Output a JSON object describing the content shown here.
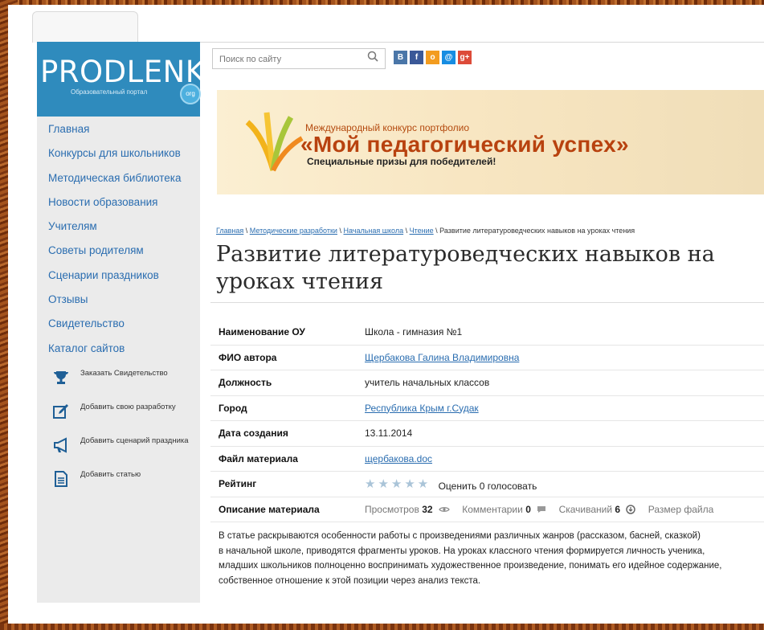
{
  "logo": {
    "text": "PRODLENKA",
    "subtitle": "Образовательный портал",
    "badge": "org"
  },
  "nav": [
    "Главная",
    "Конкурсы для школьников",
    "Методическая библиотека",
    "Новости образования",
    "Учителям",
    "Советы родителям",
    "Сценарии праздников",
    "Отзывы",
    "Свидетельство",
    "Каталог сайтов"
  ],
  "actions": [
    {
      "icon": "trophy-icon",
      "label": "Заказать Свидетельство"
    },
    {
      "icon": "edit-icon",
      "label": "Добавить свою разработку"
    },
    {
      "icon": "megaphone-icon",
      "label": "Добавить сценарий праздника"
    },
    {
      "icon": "document-icon",
      "label": "Добавить статью"
    }
  ],
  "search": {
    "placeholder": "Поиск по сайту"
  },
  "social": [
    {
      "label": "B",
      "color": "#4a76a8"
    },
    {
      "label": "f",
      "color": "#3b5998"
    },
    {
      "label": "o",
      "color": "#f39c1f"
    },
    {
      "label": "@",
      "color": "#168de2"
    },
    {
      "label": "g+",
      "color": "#dd4b39"
    }
  ],
  "banner": {
    "line1": "Международный конкурс портфолио",
    "line2": "«Мой педагогический успех»",
    "line3": "Специальные призы для победителей!"
  },
  "breadcrumb": {
    "items": [
      "Главная",
      "Методические разработки",
      "Начальная школа",
      "Чтение"
    ],
    "current": "Развитие литературоведческих навыков на уроках чтения"
  },
  "title": "Развитие литературоведческих навыков на уроках чтения",
  "info": {
    "org_label": "Наименование ОУ",
    "org_value": "Школа - гимназия №1",
    "author_label": "ФИО автора",
    "author_value": "Щербакова Галина Владимировна",
    "position_label": "Должность",
    "position_value": "учитель начальных классов",
    "city_label": "Город",
    "city_value": "Республика Крым г.Судак",
    "date_label": "Дата создания",
    "date_value": "13.11.2014",
    "file_label": "Файл материала",
    "file_value": "щербакова.doc",
    "rating_label": "Рейтинг",
    "rating_stars": "★★★★★",
    "rate_link": "Оценить",
    "votes": "0 голосовать",
    "desc_label": "Описание материала",
    "views_label": "Просмотров",
    "views_value": "32",
    "comments_label": "Комментарии",
    "comments_value": "0",
    "downloads_label": "Скачиваний",
    "downloads_value": "6",
    "size_label": "Размер файла"
  },
  "description": [
    "В статье раскрываются особенности работы с произведениями различных жанров (рассказом, басней, сказкой)",
    "в начальной школе, приводятся фрагменты уроков. На уроках классного чтения формируется личность ученика,",
    "младших школьников полноценно воспринимать художественное произведение, понимать его идейное содержание,",
    "собственное отношение к этой позиции через анализ текста."
  ]
}
